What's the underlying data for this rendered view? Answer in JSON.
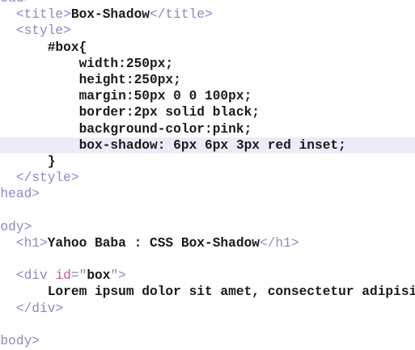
{
  "lines": [
    {
      "parts": [
        {
          "cls": "t",
          "text": "<head>"
        }
      ]
    },
    {
      "parts": [
        {
          "cls": "t",
          "text": "    <title>"
        },
        {
          "cls": "k",
          "text": "Box-Shadow"
        },
        {
          "cls": "t",
          "text": "</title>"
        }
      ]
    },
    {
      "parts": [
        {
          "cls": "t",
          "text": "    <style>"
        }
      ]
    },
    {
      "parts": [
        {
          "cls": "sel",
          "text": "        #box{"
        }
      ]
    },
    {
      "parts": [
        {
          "cls": "prop",
          "text": "            width:250px;"
        }
      ]
    },
    {
      "parts": [
        {
          "cls": "prop",
          "text": "            height:250px;"
        }
      ]
    },
    {
      "parts": [
        {
          "cls": "prop",
          "text": "            margin:50px 0 0 100px;"
        }
      ]
    },
    {
      "parts": [
        {
          "cls": "prop",
          "text": "            border:2px solid black;"
        }
      ]
    },
    {
      "parts": [
        {
          "cls": "prop",
          "text": "            background-color:pink;"
        }
      ]
    },
    {
      "highlight": true,
      "parts": [
        {
          "cls": "prop",
          "text": "            box-shadow: 6px 6px 3px red inset;"
        }
      ]
    },
    {
      "parts": [
        {
          "cls": "sel",
          "text": "        }"
        }
      ]
    },
    {
      "parts": [
        {
          "cls": "t",
          "text": "    </style>"
        }
      ]
    },
    {
      "parts": [
        {
          "cls": "t",
          "text": "</head>"
        }
      ]
    },
    {
      "parts": [
        {
          "cls": "t",
          "text": ""
        }
      ]
    },
    {
      "parts": [
        {
          "cls": "t",
          "text": "<body>"
        }
      ]
    },
    {
      "parts": [
        {
          "cls": "t",
          "text": "    <h1>"
        },
        {
          "cls": "k",
          "text": "Yahoo Baba : CSS Box-Shadow"
        },
        {
          "cls": "t",
          "text": "</h1>"
        }
      ]
    },
    {
      "parts": [
        {
          "cls": "t",
          "text": ""
        }
      ]
    },
    {
      "parts": [
        {
          "cls": "t",
          "text": "    <div "
        },
        {
          "cls": "a",
          "text": "id"
        },
        {
          "cls": "p",
          "text": "=\""
        },
        {
          "cls": "v",
          "text": "box"
        },
        {
          "cls": "p",
          "text": "\">"
        }
      ]
    },
    {
      "parts": [
        {
          "cls": "k",
          "text": "        Lorem ipsum dolor sit amet, consectetur adipisicing elit."
        }
      ]
    },
    {
      "parts": [
        {
          "cls": "t",
          "text": "    </div>"
        }
      ]
    },
    {
      "parts": [
        {
          "cls": "t",
          "text": ""
        }
      ]
    },
    {
      "parts": [
        {
          "cls": "t",
          "text": "</body>"
        }
      ]
    }
  ]
}
